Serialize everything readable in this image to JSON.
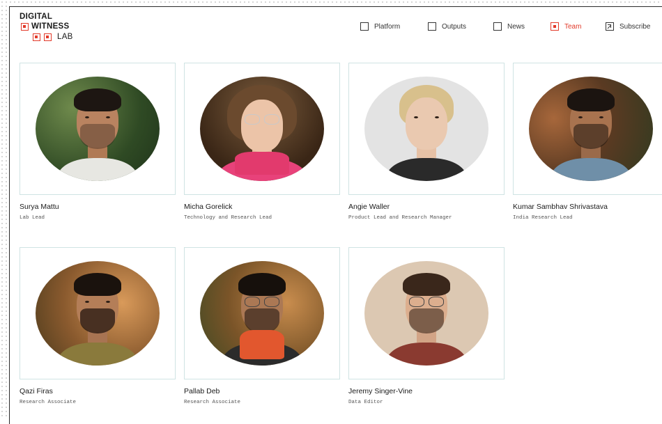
{
  "logo": {
    "line1": "DIGITAL",
    "line2": "WITNESS",
    "line3": "LAB"
  },
  "nav": [
    {
      "label": "Platform",
      "active": false,
      "icon": "checkbox-icon"
    },
    {
      "label": "Outputs",
      "active": false,
      "icon": "checkbox-icon"
    },
    {
      "label": "News",
      "active": false,
      "icon": "checkbox-icon"
    },
    {
      "label": "Team",
      "active": true,
      "icon": "checkbox-filled-icon"
    },
    {
      "label": "Subscribe",
      "active": false,
      "icon": "external-arrow-icon"
    }
  ],
  "team": [
    {
      "name": "Surya Mattu",
      "role": "Lab Lead"
    },
    {
      "name": "Micha Gorelick",
      "role": "Technology and Research Lead"
    },
    {
      "name": "Angie Waller",
      "role": "Product Lead and Research Manager"
    },
    {
      "name": "Kumar Sambhav Shrivastava",
      "role": "India Research Lead"
    },
    {
      "name": "Qazi Firas",
      "role": "Research Associate"
    },
    {
      "name": "Pallab Deb",
      "role": "Research Associate"
    },
    {
      "name": "Jeremy Singer-Vine",
      "role": "Data Editor"
    }
  ],
  "colors": {
    "accent": "#e23a2a",
    "card_border": "#cfe3e3"
  }
}
